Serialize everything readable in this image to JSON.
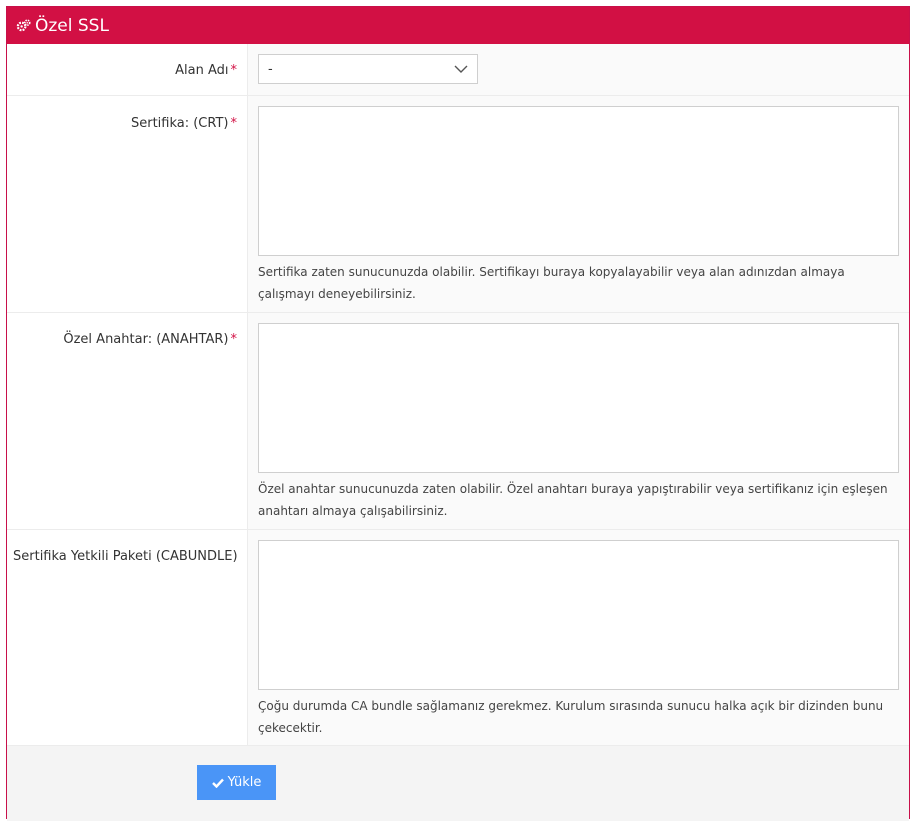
{
  "panel": {
    "title": "Özel SSL",
    "icon": "cogs-icon",
    "accent_color": "#d21044"
  },
  "form": {
    "domain": {
      "label": "Alan Adı",
      "required_mark": "*",
      "value": "-"
    },
    "certificate": {
      "label": "Sertifika: (CRT)",
      "required_mark": "*",
      "value": "",
      "help": "Sertifika zaten sunucunuzda olabilir. Sertifikayı buraya kopyalayabilir veya alan adınızdan almaya çalışmayı deneyebilirsiniz."
    },
    "private_key": {
      "label": "Özel Anahtar: (ANAHTAR)",
      "required_mark": "*",
      "value": "",
      "help": "Özel anahtar sunucunuzda zaten olabilir. Özel anahtarı buraya yapıştırabilir veya sertifikanız için eşleşen anahtarı almaya çalışabilirsiniz."
    },
    "cabundle": {
      "label": "Sertifika Yetkili Paketi (CABUNDLE)",
      "value": "",
      "help": "Çoğu durumda CA bundle sağlamanız gerekmez. Kurulum sırasında sunucu halka açık bir dizinden bunu çekecektir."
    }
  },
  "footer": {
    "submit_label": "Yükle",
    "submit_color": "#4a95f7"
  }
}
